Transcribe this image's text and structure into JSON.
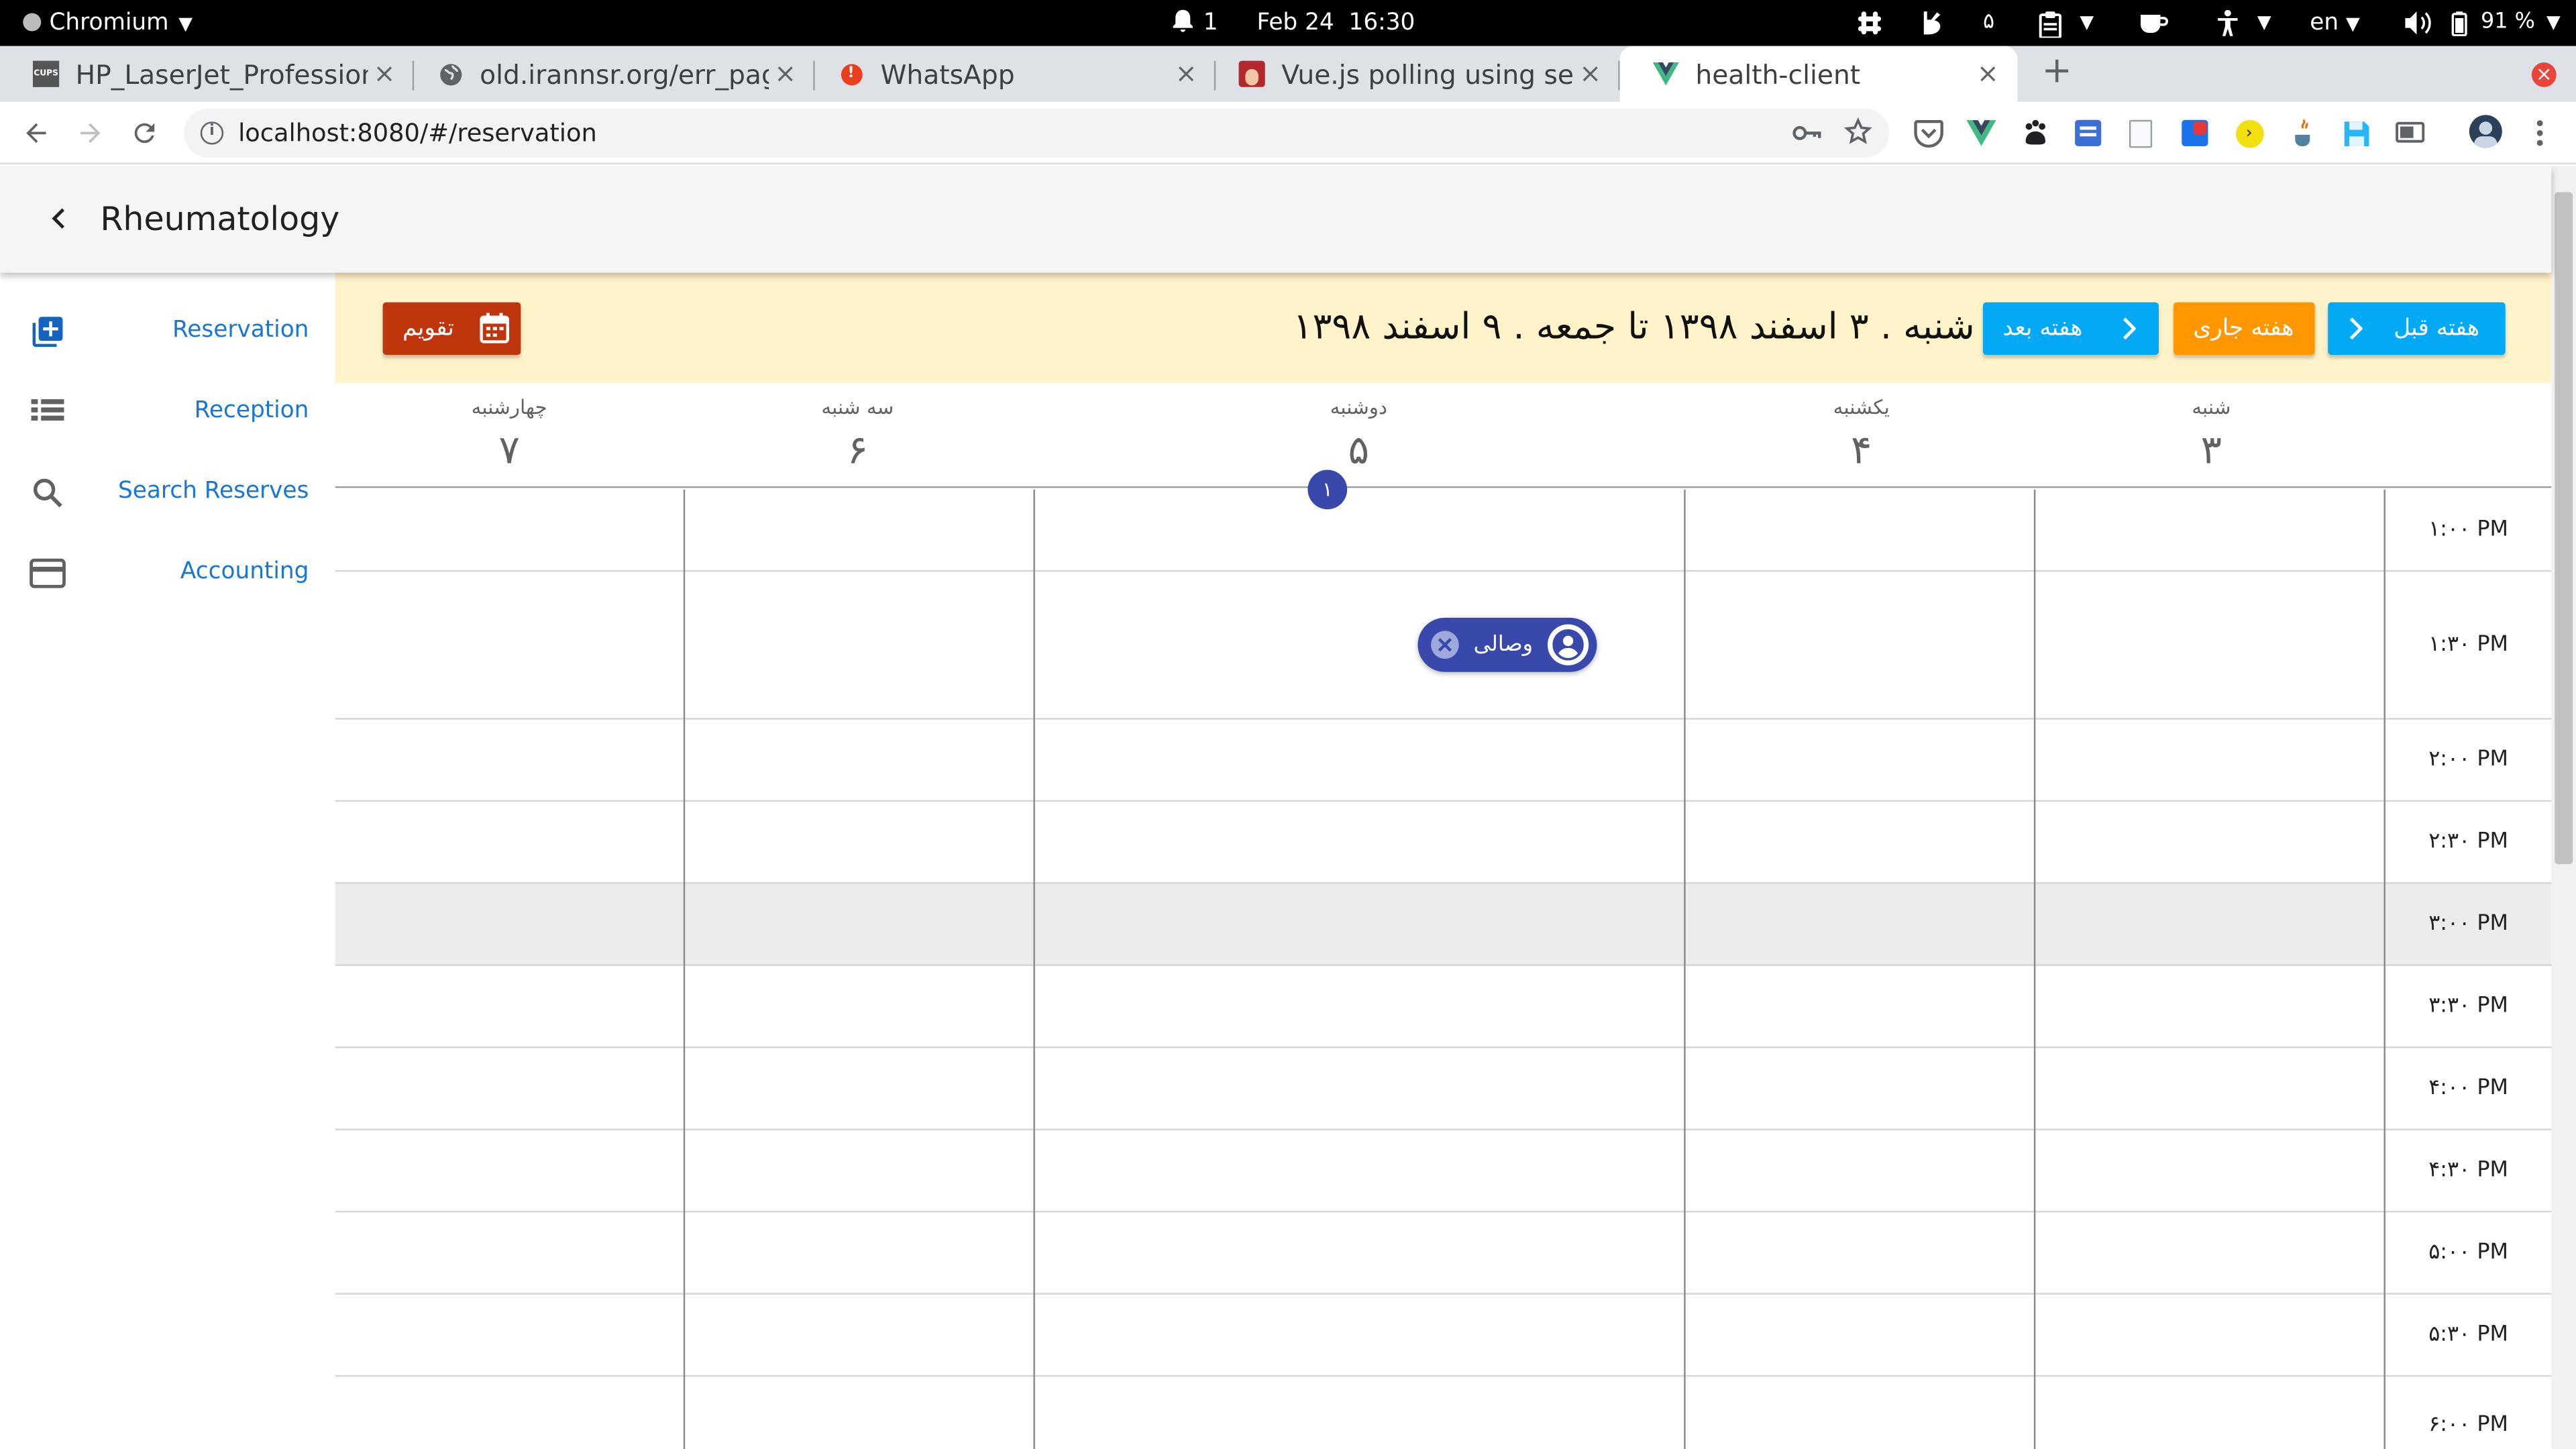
{
  "system": {
    "app_menu": "Chromium",
    "notifications_count": "1",
    "clock_date": "Feb 24",
    "clock_time": "16:30",
    "workspace_number": "۵",
    "keyboard_layout": "en",
    "battery_percent": "91 %"
  },
  "browser": {
    "tabs": [
      {
        "title": "HP_LaserJet_Professional",
        "favicon": "cups-icon"
      },
      {
        "title": "old.irannsr.org/err_page",
        "favicon": "globe-icon"
      },
      {
        "title": "WhatsApp",
        "favicon": "whatsapp-icon"
      },
      {
        "title": "Vue.js polling using set",
        "favicon": "avatar-favicon"
      },
      {
        "title": "health-client",
        "favicon": "vue-icon",
        "active": true
      }
    ],
    "url": "localhost:8080/#/reservation"
  },
  "app": {
    "title": "Rheumatology",
    "sidebar": [
      {
        "label": "Reservation",
        "icon": "add-box-icon"
      },
      {
        "label": "Reception",
        "icon": "list-icon"
      },
      {
        "label": "Search Reserves",
        "icon": "search-icon"
      },
      {
        "label": "Accounting",
        "icon": "credit-card-icon"
      }
    ],
    "calendar": {
      "calendar_button": "تقویم",
      "range_text": "شنبه . ۳ اسفند ۱۳۹۸ تا جمعه . ۹ اسفند ۱۳۹۸",
      "prev_week": "هفته قبل",
      "current_week": "هفته جاری",
      "next_week": "هفته بعد",
      "days": [
        {
          "weekday": "شنبه",
          "date": "۳"
        },
        {
          "weekday": "یکشنبه",
          "date": "۴"
        },
        {
          "weekday": "دوشنبه",
          "date": "۵"
        },
        {
          "weekday": "سه شنبه",
          "date": "۶"
        },
        {
          "weekday": "چهارشنبه",
          "date": "۷"
        }
      ],
      "monday_badge": "۱",
      "times": [
        "۱:۰۰ PM",
        "۱:۳۰ PM",
        "۲:۰۰ PM",
        "۲:۳۰ PM",
        "۳:۰۰ PM",
        "۳:۳۰ PM",
        "۴:۰۰ PM",
        "۴:۳۰ PM",
        "۵:۰۰ PM",
        "۵:۳۰ PM",
        "۶:۰۰ PM"
      ],
      "appointment": {
        "name": "وصالی",
        "day": "دوشنبه",
        "time": "۱:۳۰ PM"
      }
    }
  },
  "colors": {
    "nav_blue": "#1976d2",
    "calendar_header": "#fff3c9",
    "cyan_button": "#03a9f4",
    "orange_button": "#ff9800",
    "calendar_button": "#bf360c",
    "event_indigo": "#3949ab"
  }
}
